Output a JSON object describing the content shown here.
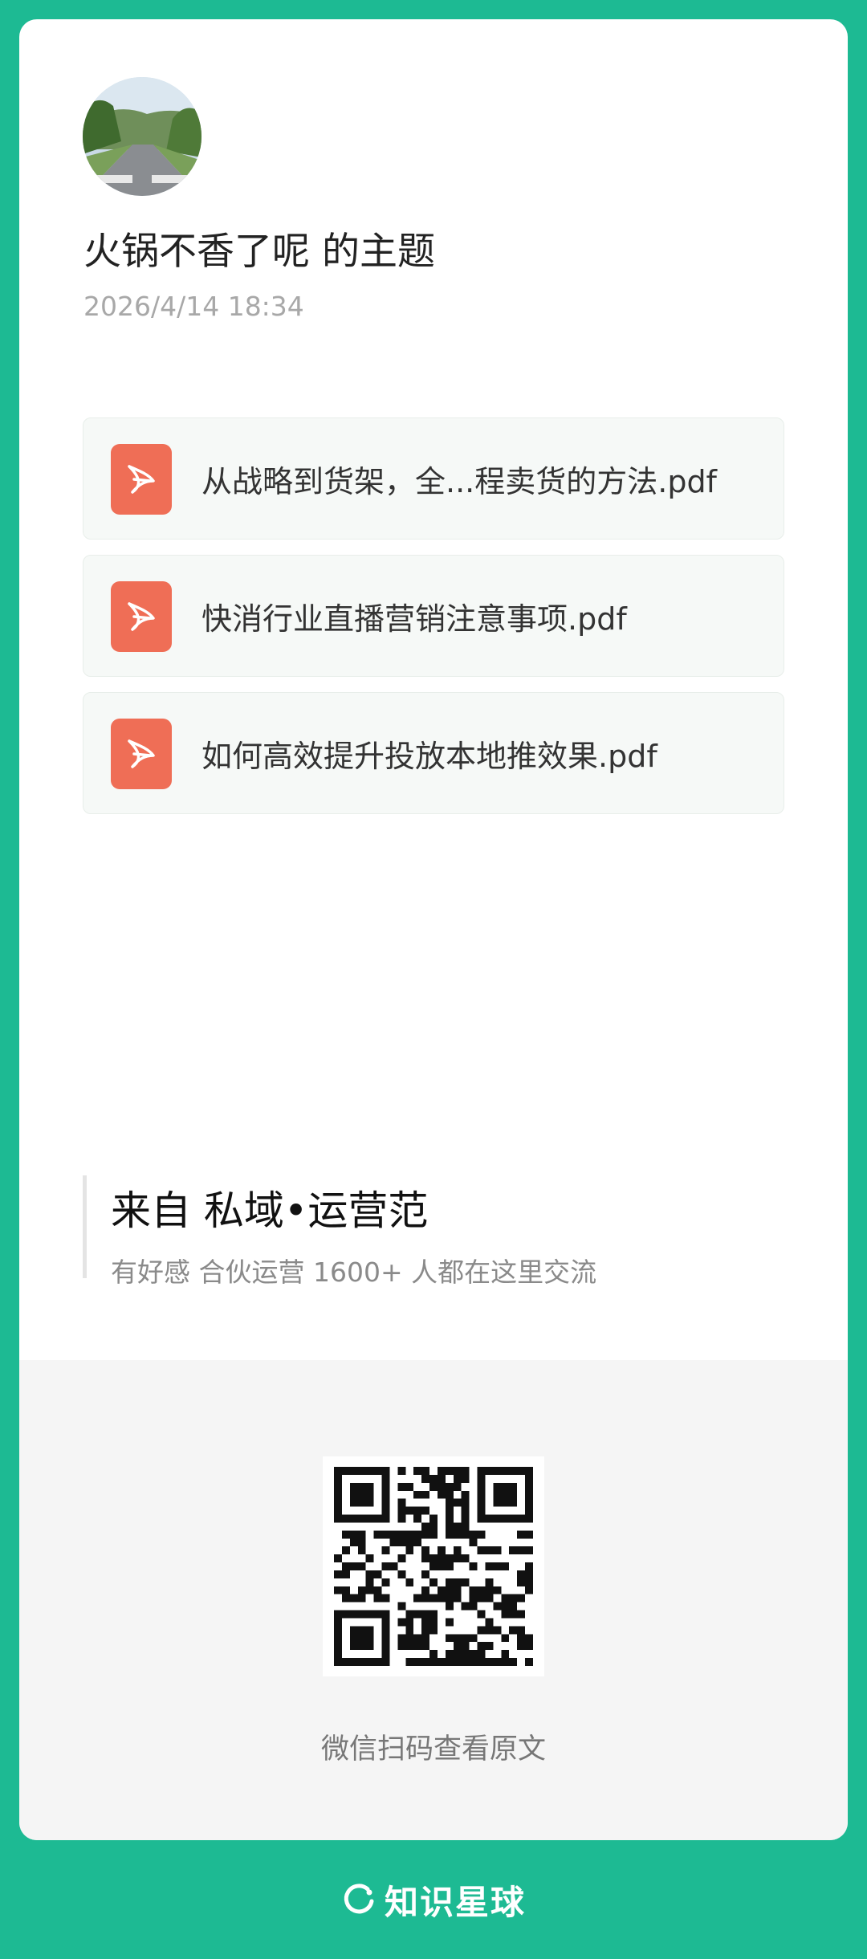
{
  "post": {
    "author_avatar": "avatar-road-photo",
    "title": "火锅不香了呢 的主题",
    "timestamp": "2026/4/14 18:34"
  },
  "attachments": [
    {
      "icon": "pdf-icon",
      "name": "从战略到货架，全...程卖货的方法.pdf"
    },
    {
      "icon": "pdf-icon",
      "name": "快消行业直播营销注意事项.pdf"
    },
    {
      "icon": "pdf-icon",
      "name": "如何高效提升投放本地推效果.pdf"
    }
  ],
  "source": {
    "title": "来自 私域•运营范",
    "description": "有好感 合伙运营 1600+ 人都在这里交流"
  },
  "qr": {
    "icon": "qr-code",
    "caption": "微信扫码查看原文"
  },
  "brand": {
    "logo": "zsxq-logo-icon",
    "name": "知识星球"
  },
  "colors": {
    "background": "#1dba93",
    "pdf_icon": "#ef6e56",
    "card": "#ffffff",
    "qr_section": "#f5f5f5"
  }
}
